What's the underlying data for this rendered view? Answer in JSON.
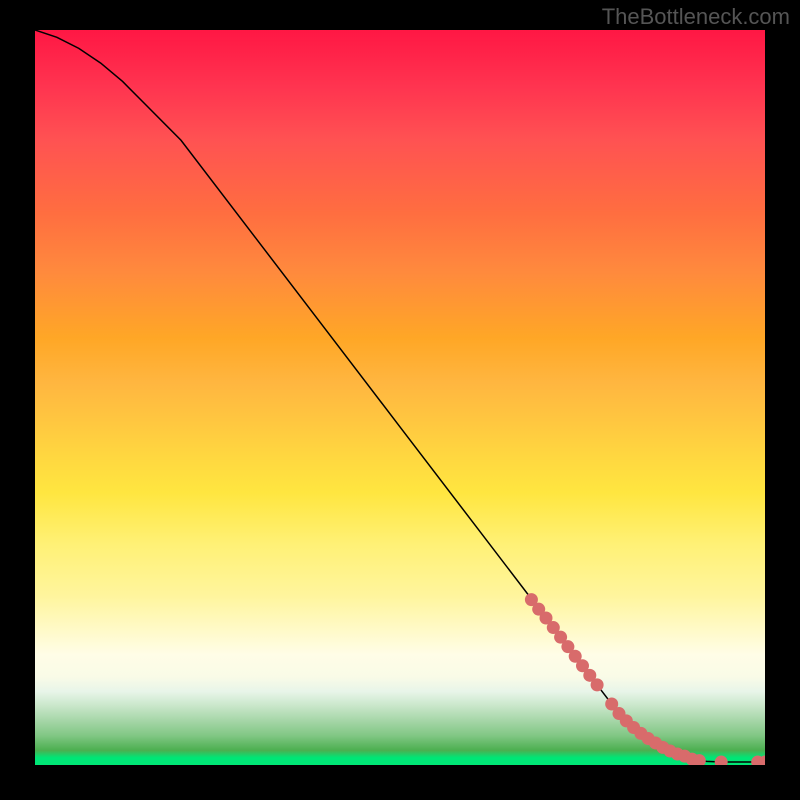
{
  "watermark": "TheBottleneck.com",
  "chart_data": {
    "type": "line",
    "title": "",
    "xlabel": "",
    "ylabel": "",
    "xlim": [
      0,
      100
    ],
    "ylim": [
      0,
      100
    ],
    "curve": {
      "name": "curve",
      "x": [
        0,
        3,
        6,
        9,
        12,
        15,
        20,
        30,
        40,
        50,
        60,
        70,
        80,
        85,
        88,
        90,
        92,
        94,
        96,
        98,
        100
      ],
      "y": [
        100,
        99,
        97.5,
        95.5,
        93,
        90,
        85,
        72,
        59,
        46,
        33,
        20,
        7,
        3,
        1.5,
        0.8,
        0.5,
        0.4,
        0.4,
        0.4,
        0.4
      ]
    },
    "points_on_curve": {
      "name": "scatter-points",
      "x": [
        68,
        69,
        70,
        71,
        72,
        73,
        74,
        75,
        76,
        77,
        79,
        80,
        81,
        82,
        83,
        84,
        85,
        86,
        87,
        88,
        89,
        90,
        91,
        94,
        99,
        100
      ],
      "y": [
        22.5,
        21.2,
        20,
        18.7,
        17.4,
        16.1,
        14.8,
        13.5,
        12.2,
        10.9,
        8.3,
        7,
        6,
        5.1,
        4.3,
        3.6,
        3.0,
        2.4,
        1.9,
        1.5,
        1.2,
        0.8,
        0.6,
        0.4,
        0.4,
        0.4
      ]
    }
  },
  "colors": {
    "point_fill": "#d86b6b",
    "curve_stroke": "#000000",
    "background": "#000000"
  }
}
